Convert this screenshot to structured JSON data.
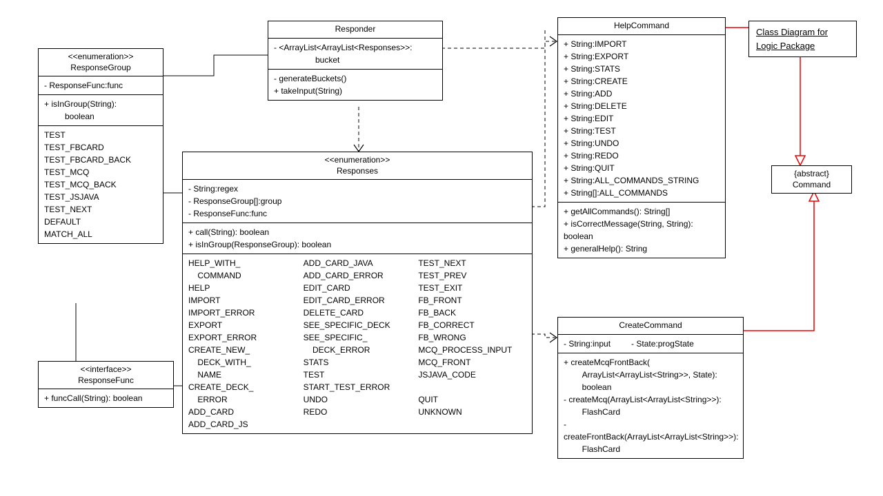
{
  "diagramTitle": "Class Diagram for Logic Package",
  "responseGroup": {
    "stereotype": "<<enumeration>>",
    "name": "ResponseGroup",
    "attrs": "- ResponseFunc:func",
    "ops": "+ isInGroup(String):",
    "opsRet": "boolean",
    "values": [
      "TEST",
      "TEST_FBCARD",
      "TEST_FBCARD_BACK",
      "TEST_MCQ",
      "TEST_MCQ_BACK",
      "TEST_JSJAVA",
      "TEST_NEXT",
      "DEFAULT",
      "MATCH_ALL"
    ]
  },
  "responseFunc": {
    "stereotype": "<<interface>>",
    "name": "ResponseFunc",
    "ops": "+ funcCall(String): boolean"
  },
  "responder": {
    "name": "Responder",
    "attrs_l1": "- <ArrayList<ArrayList<Responses>>:",
    "attrs_l2": "bucket",
    "ops_l1": "- generateBuckets()",
    "ops_l2": "+ takeInput(String)"
  },
  "responses": {
    "stereotype": "<<enumeration>>",
    "name": "Responses",
    "attrs": [
      "- String:regex",
      "- ResponseGroup[]:group",
      "- ResponseFunc:func"
    ],
    "ops": [
      "+ call(String): boolean",
      "+ isInGroup(ResponseGroup): boolean"
    ],
    "col1": [
      "HELP_WITH_",
      "    COMMAND",
      "HELP",
      "IMPORT",
      "IMPORT_ERROR",
      "EXPORT",
      "EXPORT_ERROR",
      "CREATE_NEW_",
      "    DECK_WITH_",
      "    NAME",
      "CREATE_DECK_",
      "    ERROR",
      "ADD_CARD",
      "ADD_CARD_JS"
    ],
    "col2": [
      "ADD_CARD_JAVA",
      "ADD_CARD_ERROR",
      "EDIT_CARD",
      "EDIT_CARD_ERROR",
      "DELETE_CARD",
      "SEE_SPECIFIC_DECK",
      "SEE_SPECIFIC_",
      "    DECK_ERROR",
      "STATS",
      "TEST",
      "START_TEST_ERROR",
      "UNDO",
      "REDO"
    ],
    "col3": [
      "TEST_NEXT",
      "TEST_PREV",
      "TEST_EXIT",
      "FB_FRONT",
      "FB_BACK",
      "FB_CORRECT",
      "FB_WRONG",
      "MCQ_PROCESS_INPUT",
      "MCQ_FRONT",
      "JSJAVA_CODE",
      "",
      "QUIT",
      "UNKNOWN"
    ]
  },
  "helpCommand": {
    "name": "HelpCommand",
    "attrs": [
      "+ String:IMPORT",
      "+ String:EXPORT",
      "+ String:STATS",
      "+ String:CREATE",
      "+ String:ADD",
      "+ String:DELETE",
      "+ String:EDIT",
      "+ String:TEST",
      "+ String:UNDO",
      "+ String:REDO",
      "+ String:QUIT",
      "+ String:ALL_COMMANDS_STRING",
      "+ String[]:ALL_COMMANDS"
    ],
    "ops": [
      "+ getAllCommands(): String[]",
      "+ isCorrectMessage(String, String):",
      "boolean",
      "+ generalHelp(): String"
    ]
  },
  "createCommand": {
    "name": "CreateCommand",
    "attr1": "- String:input",
    "attr2": "- State:progState",
    "ops": [
      "+ createMcqFrontBack(",
      "        ArrayList<ArrayList<String>>, State):",
      "        boolean",
      "- createMcq(ArrayList<ArrayList<String>>):",
      "        FlashCard",
      "- createFrontBack(ArrayList<ArrayList<String>>):",
      "        FlashCard"
    ]
  },
  "command": {
    "stereotype": "{abstract}",
    "name": "Command"
  }
}
